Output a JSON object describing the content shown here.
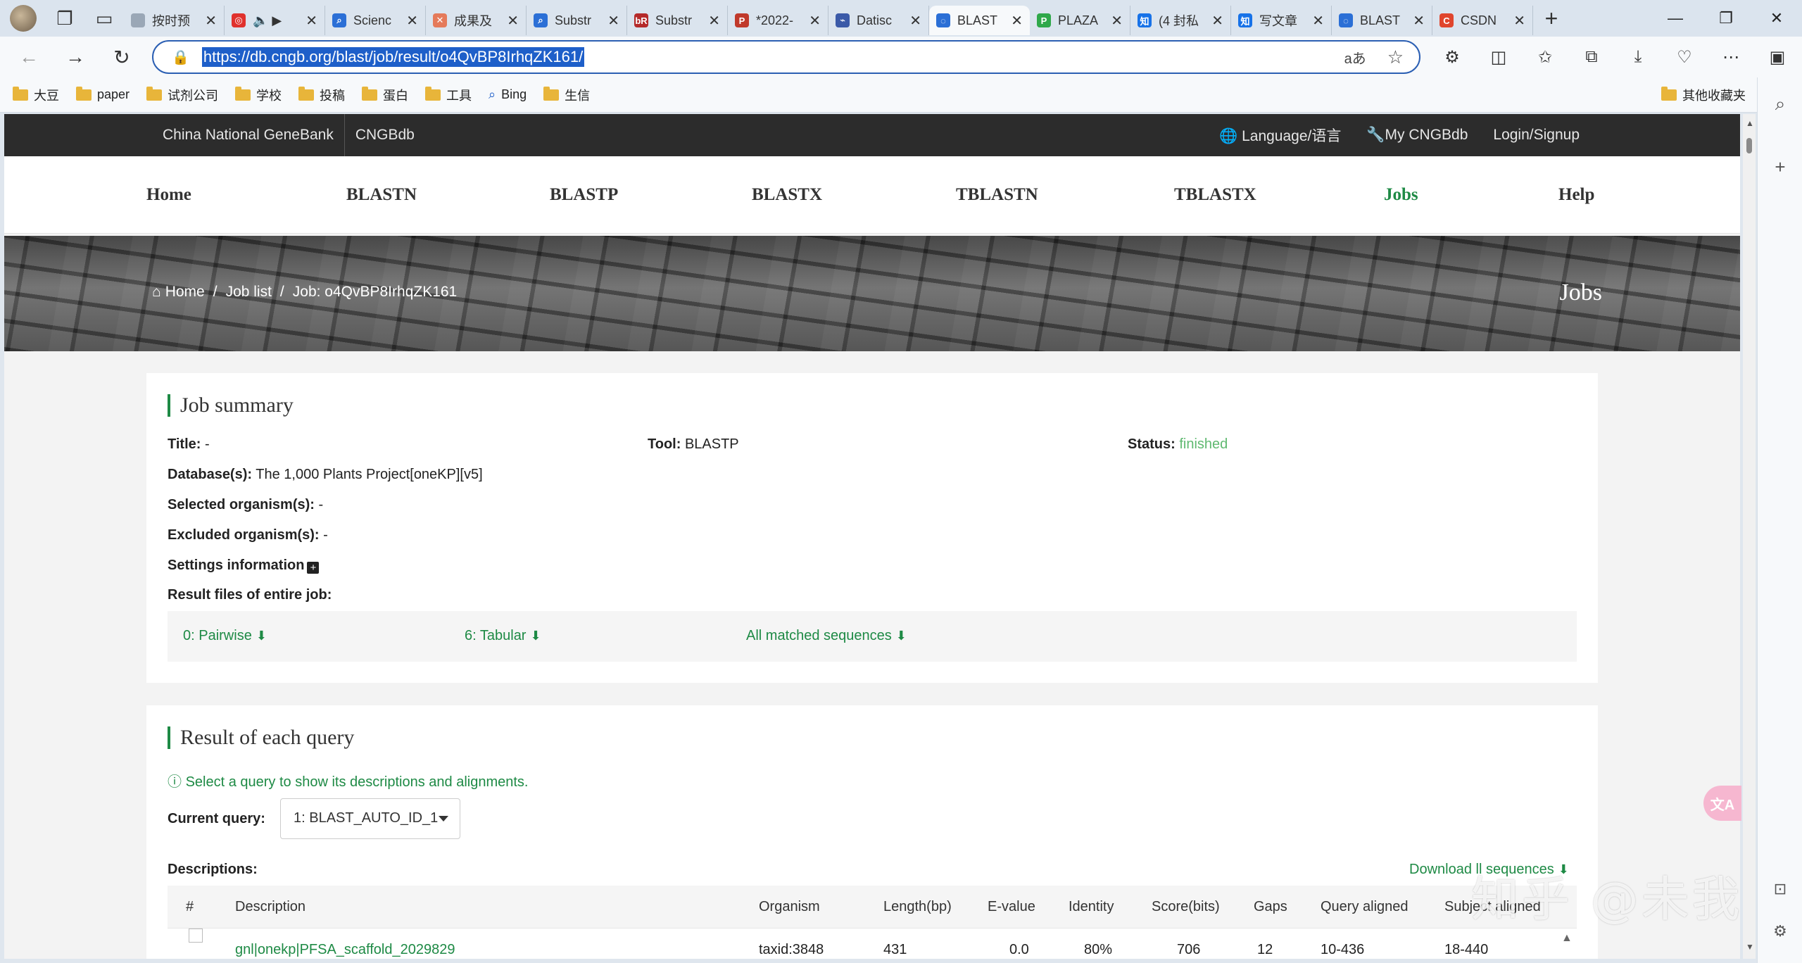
{
  "browser": {
    "tabs": [
      {
        "label": "按时预",
        "fav_color": "#9aa7b6",
        "fav_text": ""
      },
      {
        "label": "",
        "fav_color": "#e0312d",
        "fav_text": "◎"
      },
      {
        "label": "Scienc",
        "fav_color": "#2b6fd6",
        "fav_text": "⌕"
      },
      {
        "label": "成果及",
        "fav_color": "#e57a5a",
        "fav_text": "✕"
      },
      {
        "label": "Substr",
        "fav_color": "#2b6fd6",
        "fav_text": "⌕"
      },
      {
        "label": "Substr",
        "fav_color": "#b52a2a",
        "fav_text": "bR"
      },
      {
        "label": "*2022-",
        "fav_color": "#c0392b",
        "fav_text": "P"
      },
      {
        "label": "Datisc",
        "fav_color": "#3b5aa8",
        "fav_text": "⌁"
      },
      {
        "label": "BLAST",
        "fav_color": "#2b6fd6",
        "fav_text": "◌",
        "active": true
      },
      {
        "label": "PLAZA",
        "fav_color": "#2fa84a",
        "fav_text": "P"
      },
      {
        "label": "(4 封私",
        "fav_color": "#1772e8",
        "fav_text": "知"
      },
      {
        "label": "写文章",
        "fav_color": "#1772e8",
        "fav_text": "知"
      },
      {
        "label": "BLAST",
        "fav_color": "#2b6fd6",
        "fav_text": "◌"
      },
      {
        "label": "CSDN",
        "fav_color": "#e0452d",
        "fav_text": "C"
      }
    ],
    "url": "https://db.cngb.org/blast/job/result/o4QvBP8IrhqZK161/",
    "read_aloud": "aあ",
    "bookmarks": [
      "大豆",
      "paper",
      "试剂公司",
      "学校",
      "投稿",
      "蛋白",
      "工具",
      "Bing",
      "生信"
    ],
    "bookmarks_other": "其他收藏夹"
  },
  "site": {
    "top_left": [
      "China National GeneBank",
      "CNGBdb"
    ],
    "top_right": [
      "Language/语言",
      "My CNGBdb",
      "Login/Signup"
    ],
    "nav": [
      "Home",
      "BLASTN",
      "BLASTP",
      "BLASTX",
      "TBLASTN",
      "TBLASTX",
      "Jobs",
      "Help"
    ],
    "active_nav": "Jobs",
    "breadcrumb": {
      "home": "Home",
      "joblist": "Job list",
      "job": "Job: o4QvBP8IrhqZK161"
    },
    "banner_title": "Jobs"
  },
  "summary": {
    "heading": "Job summary",
    "title_label": "Title:",
    "title_value": " -",
    "tool_label": "Tool:",
    "tool_value": " BLASTP",
    "status_label": "Status:",
    "status_value": " finished",
    "db_label": "Database(s):",
    "db_value": " The 1,000 Plants Project[oneKP][v5]",
    "sel_label": "Selected organism(s):",
    "sel_value": " -",
    "exc_label": "Excluded organism(s):",
    "exc_value": " -",
    "settings_label": "Settings information",
    "files_label": "Result files of entire job:",
    "files": [
      "0: Pairwise",
      "6: Tabular",
      "All matched sequences"
    ]
  },
  "results": {
    "heading": "Result of each query",
    "hint": "Select a query to show its descriptions and alignments.",
    "query_label": "Current query:",
    "query_value": "1: BLAST_AUTO_ID_1",
    "desc_label": "Descriptions:",
    "download": "Download ",
    "download_tail": "ll sequences",
    "columns": [
      "#",
      "Description",
      "Organism",
      "Length(bp)",
      "E-value",
      "Identity",
      "Score(bits)",
      "Gaps",
      "Query aligned",
      "Subject aligned"
    ],
    "rows": [
      {
        "desc": "gnl|onekp|PFSA_scaffold_2029829",
        "organism": "taxid:3848",
        "length": "431",
        "evalue": "0.0",
        "identity": "80%",
        "score": "706",
        "gaps": "12",
        "qaligned": "10-436",
        "saligned": "18-440"
      }
    ]
  },
  "overlay": {
    "watermark": "知乎 @未我",
    "translate_badge": "文A"
  }
}
